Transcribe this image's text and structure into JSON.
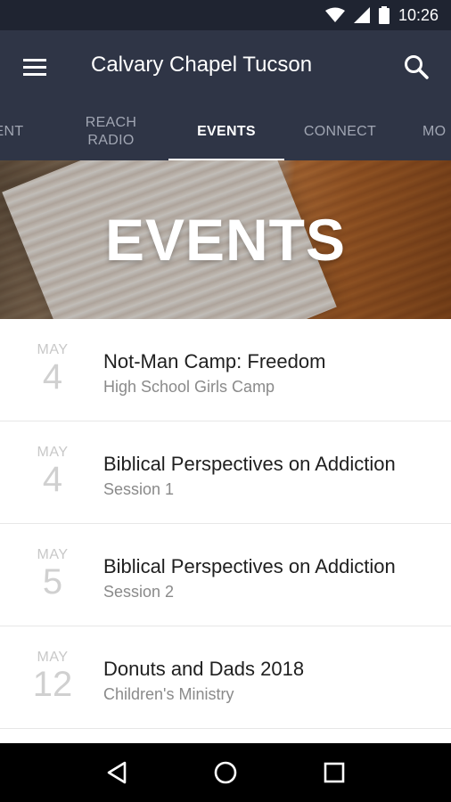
{
  "status_bar": {
    "time": "10:26"
  },
  "app_bar": {
    "title": "Calvary Chapel Tucson"
  },
  "tabs": [
    {
      "label": "ENT",
      "active": false
    },
    {
      "label": "REACH\nRADIO",
      "active": false
    },
    {
      "label": "EVENTS",
      "active": true
    },
    {
      "label": "CONNECT",
      "active": false
    },
    {
      "label": "MO",
      "active": false
    }
  ],
  "hero": {
    "title": "EVENTS"
  },
  "events": [
    {
      "month": "MAY",
      "day": "4",
      "title": "Not-Man Camp: Freedom",
      "subtitle": "High School Girls Camp"
    },
    {
      "month": "MAY",
      "day": "4",
      "title": "Biblical Perspectives on Addiction",
      "subtitle": "Session 1"
    },
    {
      "month": "MAY",
      "day": "5",
      "title": "Biblical Perspectives on Addiction",
      "subtitle": "Session 2"
    },
    {
      "month": "MAY",
      "day": "12",
      "title": "Donuts and Dads 2018",
      "subtitle": "Children's Ministry"
    }
  ],
  "colors": {
    "status_bar": "#1f2431",
    "app_bar": "#2f3546",
    "tab_inactive": "#a1a6b3",
    "tab_active": "#ffffff",
    "date_text": "#c8c8c8"
  },
  "icons": {
    "status": [
      "wifi-icon",
      "signal-icon",
      "battery-icon"
    ],
    "app_bar": [
      "menu-icon",
      "search-icon"
    ],
    "nav": [
      "back-icon",
      "home-icon",
      "recents-icon"
    ]
  }
}
